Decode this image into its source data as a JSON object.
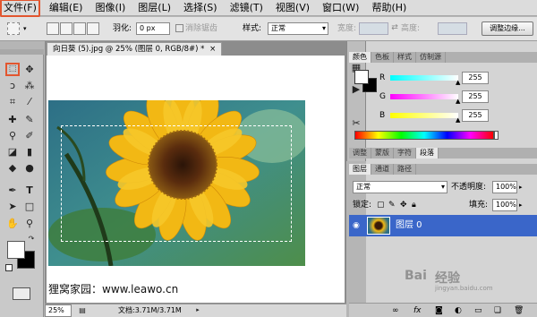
{
  "menu": [
    "文件(F)",
    "编辑(E)",
    "图像(I)",
    "图层(L)",
    "选择(S)",
    "滤镜(T)",
    "视图(V)",
    "窗口(W)",
    "帮助(H)"
  ],
  "options": {
    "feather_label": "羽化:",
    "feather_value": "0 px",
    "antialias_label": "消除锯齿",
    "style_label": "样式:",
    "style_value": "正常",
    "width_label": "宽度:",
    "height_label": "高度:",
    "refine_button": "调整边缘..."
  },
  "document": {
    "tab_title": "向日葵 (5).jpg @ 25% (图层 0, RGB/8#) *",
    "overlay_text": "狸窝家园：www.leawo.cn"
  },
  "status": {
    "zoom": "25%",
    "doc_info": "文档:3.71M/3.71M"
  },
  "color_panel": {
    "tabs": [
      "颜色",
      "色板",
      "样式",
      "仿制源"
    ],
    "channels": [
      {
        "label": "R",
        "value": "255",
        "color": "#00c8c8"
      },
      {
        "label": "G",
        "value": "255",
        "color": "#d040d0"
      },
      {
        "label": "B",
        "value": "255",
        "color": "#d8d800"
      }
    ]
  },
  "adjust_tabs": [
    "调整",
    "蒙版",
    "字符",
    "段落"
  ],
  "layers_panel": {
    "tabs": [
      "图层",
      "通道",
      "路径"
    ],
    "blend_mode": "正常",
    "opacity_label": "不透明度:",
    "opacity_value": "100%",
    "lock_label": "锁定:",
    "fill_label": "填充:",
    "fill_value": "100%",
    "layer_name": "图层 0"
  },
  "watermark": [
    "Bai",
    "经验",
    "jingyan.baidu.com"
  ],
  "accent_colors": {
    "highlight": "#e2562f",
    "layer_selected": "#3a66c9"
  }
}
